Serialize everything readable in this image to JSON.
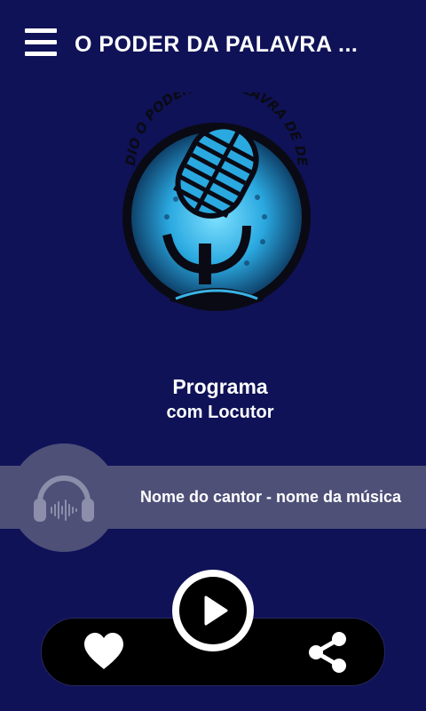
{
  "header": {
    "menu_icon": "hamburger-menu-icon",
    "title": "O PODER DA PALAVRA ..."
  },
  "logo": {
    "arc_text": "RADIO O PODER DA PALAVRA DE DEUS",
    "icon": "microphone-logo"
  },
  "program": {
    "title": "Programa",
    "host": "com Locutor"
  },
  "now_playing": {
    "icon": "headphones-icon",
    "song": "Nome do cantor - nome da música"
  },
  "controls": {
    "like_icon": "heart-icon",
    "play_icon": "play-icon",
    "share_icon": "share-icon"
  },
  "colors": {
    "background": "#0f1257",
    "bar": "#4e5078",
    "accent": "#3ab4e6",
    "controls_bg": "#000000"
  }
}
